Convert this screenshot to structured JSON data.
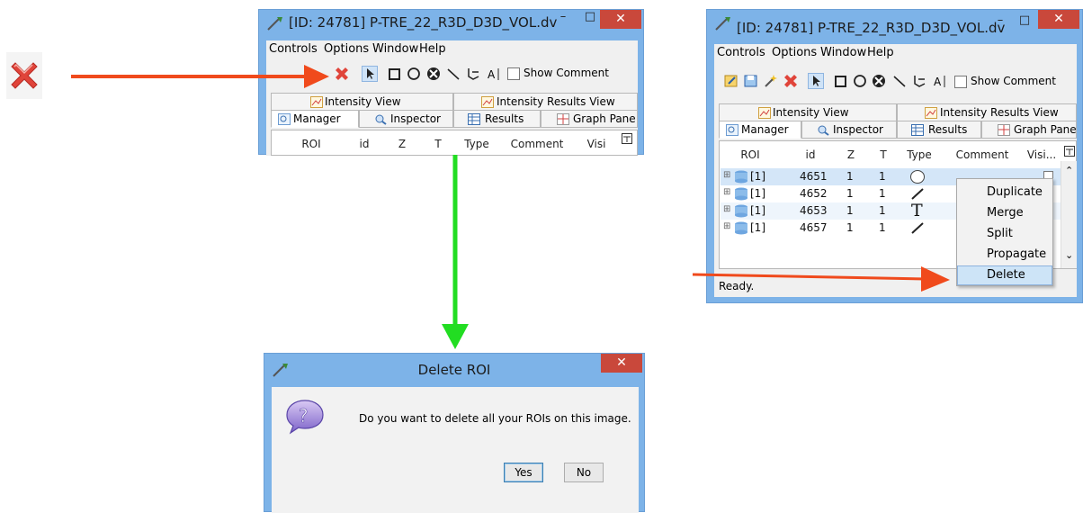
{
  "colors": {
    "arrow_red": "#f04a1c",
    "arrow_green": "#22dd22",
    "window_frame": "#7db3e8",
    "close_button": "#c9483b",
    "selection": "#cde4f7"
  },
  "delete_icon": "red-x-delete-icon",
  "window_small": {
    "title": "[ID: 24781] P-TRE_22_R3D_D3D_VOL.dv",
    "menu": [
      "Controls",
      "Options",
      "Window",
      "Help"
    ],
    "toolbar": {
      "show_comment": "Show Comment"
    },
    "tabs_top": [
      "Intensity View",
      "Intensity Results View"
    ],
    "tabs_bottom": [
      "Manager",
      "Inspector",
      "Results",
      "Graph Pane"
    ],
    "columns": [
      "ROI",
      "id",
      "Z",
      "T",
      "Type",
      "Comment",
      "Visi"
    ]
  },
  "window_large": {
    "title": "[ID: 24781] P-TRE_22_R3D_D3D_VOL.dv",
    "menu": [
      "Controls",
      "Options",
      "Window",
      "Help"
    ],
    "toolbar": {
      "show_comment": "Show Comment"
    },
    "tabs_top": [
      "Intensity View",
      "Intensity Results View"
    ],
    "tabs_bottom": [
      "Manager",
      "Inspector",
      "Results",
      "Graph Pane"
    ],
    "columns": [
      "ROI",
      "id",
      "Z",
      "T",
      "Type",
      "Comment",
      "Visi..."
    ],
    "rows": [
      {
        "roi": "[1]",
        "id": "4651",
        "z": "1",
        "t": "1",
        "type": "ellipse"
      },
      {
        "roi": "[1]",
        "id": "4652",
        "z": "1",
        "t": "1",
        "type": "line"
      },
      {
        "roi": "[1]",
        "id": "4653",
        "z": "1",
        "t": "1",
        "type": "text"
      },
      {
        "roi": "[1]",
        "id": "4657",
        "z": "1",
        "t": "1",
        "type": "line"
      }
    ],
    "type_text_glyph": "T",
    "context_menu": [
      "Duplicate",
      "Merge",
      "Split",
      "Propagate",
      "Delete"
    ],
    "status": "Ready."
  },
  "dialog": {
    "title": "Delete ROI",
    "message": "Do you want to delete all your ROIs on this image.",
    "yes_label": "Yes",
    "no_label": "No"
  }
}
